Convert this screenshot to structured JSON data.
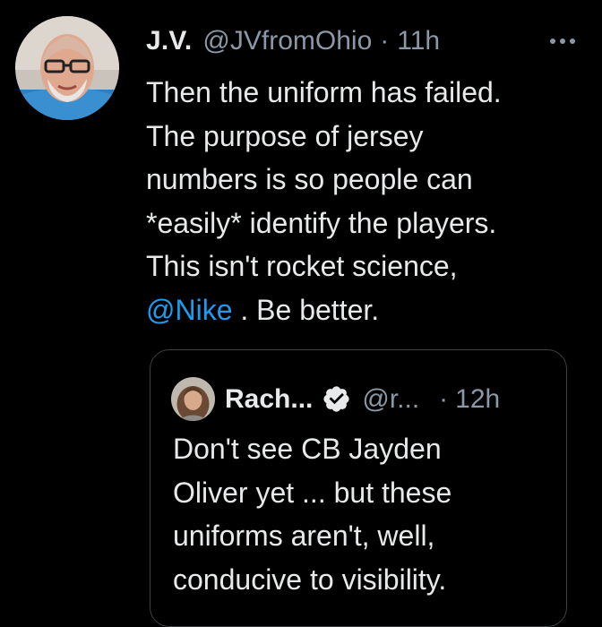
{
  "tweet": {
    "author_name": "J.V.",
    "handle": "@JVfromOhio",
    "separator": "·",
    "time": "11h",
    "text_lines": [
      "Then the uniform has failed.",
      "The purpose of jersey",
      "numbers is so people can",
      "*easily* identify the players.",
      "This isn't rocket science,"
    ],
    "mention": "@Nike",
    "last_line_after": " . Be better."
  },
  "quote": {
    "author_name": "Rach...",
    "handle": "@r...",
    "separator": "·",
    "time": "12h",
    "text_lines": [
      "Don't see CB Jayden",
      "Oliver yet ... but these",
      "uniforms aren't, well,",
      "conducive to visibility."
    ]
  },
  "icons": {
    "more": "more-icon",
    "verified": "verified-badge-icon"
  },
  "colors": {
    "background": "#000000",
    "text": "#e7e9ea",
    "secondary": "#8b98a5",
    "link": "#1d9bf0",
    "border": "#3e4144"
  }
}
